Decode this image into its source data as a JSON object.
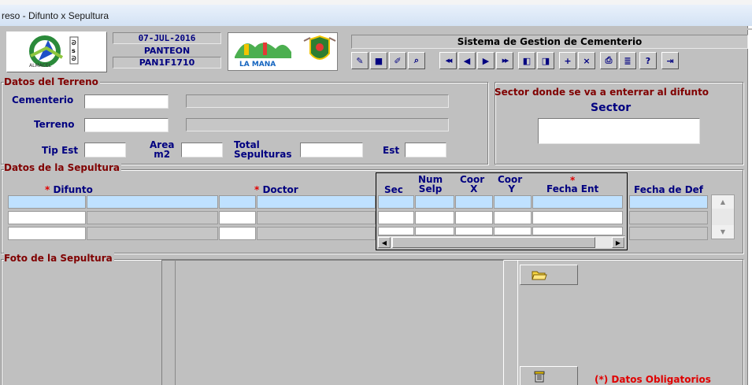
{
  "window": {
    "title": "reso - Difunto x Sepultura"
  },
  "header": {
    "date": "07-JUL-2016",
    "module": "PANTEON",
    "form_code": "PAN1F1710",
    "system_title": "Sistema de Gestion de Cementerio",
    "logo_right_text": "LA MANA",
    "logo_left_text": "ALMACEL"
  },
  "toolbar": [
    {
      "name": "clear-icon",
      "glyph": "✎"
    },
    {
      "name": "save-icon",
      "glyph": "■"
    },
    {
      "name": "edit-icon",
      "glyph": "✐"
    },
    {
      "name": "query-icon",
      "glyph": "⌕"
    },
    {
      "name": "first-record-icon",
      "glyph": "◀◀"
    },
    {
      "name": "previous-record-icon",
      "glyph": "◀"
    },
    {
      "name": "next-record-icon",
      "glyph": "▶"
    },
    {
      "name": "last-record-icon",
      "glyph": "▶▶"
    },
    {
      "name": "first-block-icon",
      "glyph": "◧"
    },
    {
      "name": "last-block-icon",
      "glyph": "◨"
    },
    {
      "name": "insert-record-icon",
      "glyph": "+"
    },
    {
      "name": "delete-record-icon",
      "glyph": "×"
    },
    {
      "name": "print-icon",
      "glyph": "⎙"
    },
    {
      "name": "report-icon",
      "glyph": "≣"
    },
    {
      "name": "help-icon",
      "glyph": "?"
    },
    {
      "name": "exit-icon",
      "glyph": "⇥"
    }
  ],
  "terreno": {
    "section_title": "Datos del Terreno",
    "cementerio_label": "Cementerio",
    "terreno_label": "Terreno",
    "tip_est_label": "Tip Est",
    "area_label": "Area\nm2",
    "total_label": "Total\nSepulturas",
    "est_label": "Est",
    "sector_title": "Sector donde se va a enterrar al difunto",
    "sector_label": "Sector"
  },
  "sepultura": {
    "section_title": "Datos de la Sepultura",
    "columns": {
      "difunto": "Difunto",
      "doctor": "Doctor",
      "sec": "Sec",
      "num_selp": "Num\nSelp",
      "coor_x": "Coor\nX",
      "coor_y": "Coor\nY",
      "fecha_ent": "Fecha Ent",
      "fecha_def": "Fecha de Def"
    },
    "required_mark": "*"
  },
  "foto": {
    "section_title": "Foto de la Sepultura",
    "required_note": "(*) Datos Obligatorios"
  },
  "colors": {
    "label_blue": "#000080",
    "section_maroon": "#800000",
    "required_red": "#e00000",
    "selected_row": "#bfe1ff"
  }
}
